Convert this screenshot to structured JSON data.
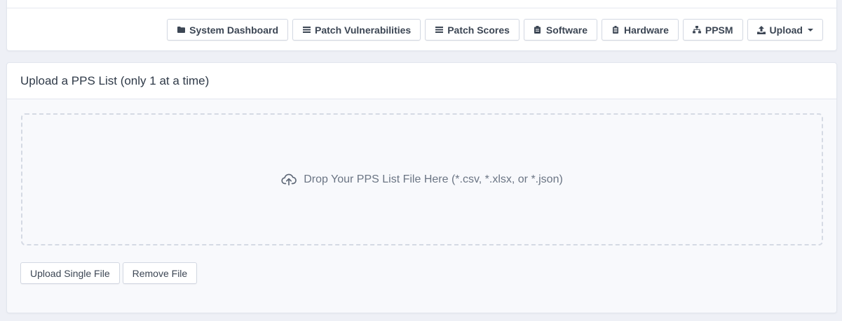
{
  "nav": {
    "buttons": [
      {
        "label": "System Dashboard",
        "icon": "folder-icon"
      },
      {
        "label": "Patch Vulnerabilities",
        "icon": "list-icon"
      },
      {
        "label": "Patch Scores",
        "icon": "list-icon"
      },
      {
        "label": "Software",
        "icon": "clipboard-icon"
      },
      {
        "label": "Hardware",
        "icon": "battery-icon"
      },
      {
        "label": "PPSM",
        "icon": "sitemap-icon"
      },
      {
        "label": "Upload",
        "icon": "upload-icon"
      }
    ]
  },
  "upload_panel": {
    "title": "Upload a PPS List (only 1 at a time)",
    "dropzone_text": "Drop Your PPS List File Here (*.csv, *.xlsx, or *.json)",
    "dropzone_icon": "cloud-upload-icon",
    "upload_button": "Upload Single File",
    "remove_button": "Remove File"
  },
  "colors": {
    "background": "#eef0f6",
    "card": "#ffffff",
    "border": "#d3d8e2",
    "text": "#3c4654",
    "muted_text": "#6b7584"
  }
}
